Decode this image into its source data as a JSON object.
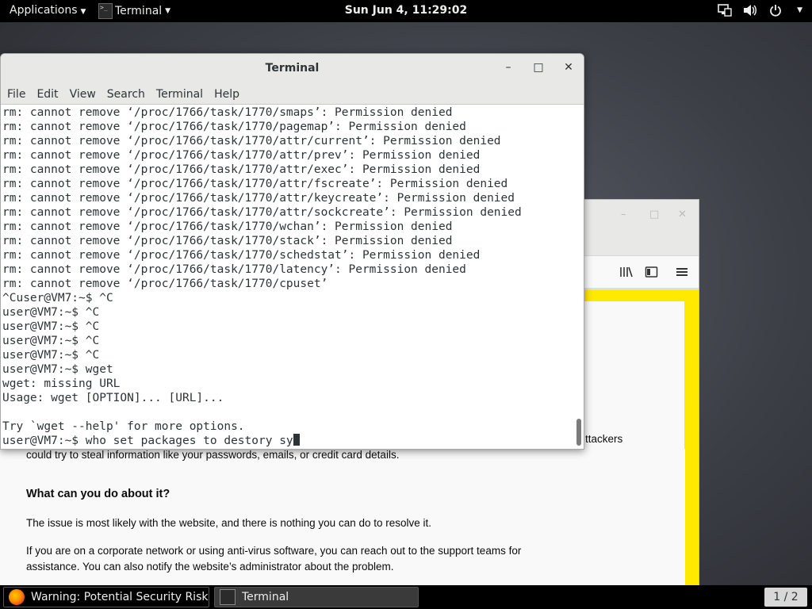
{
  "topbar": {
    "applications_label": "Applications",
    "app_menu_label": "Terminal",
    "clock": "Sun Jun  4, 11:29:02",
    "tray_icons": [
      "network-icon",
      "volume-icon",
      "power-icon"
    ]
  },
  "terminal": {
    "title": "Terminal",
    "menus": [
      "File",
      "Edit",
      "View",
      "Search",
      "Terminal",
      "Help"
    ],
    "lines": [
      "rm: cannot remove ‘/proc/1766/task/1770/smaps’: Permission denied",
      "rm: cannot remove ‘/proc/1766/task/1770/pagemap’: Permission denied",
      "rm: cannot remove ‘/proc/1766/task/1770/attr/current’: Permission denied",
      "rm: cannot remove ‘/proc/1766/task/1770/attr/prev’: Permission denied",
      "rm: cannot remove ‘/proc/1766/task/1770/attr/exec’: Permission denied",
      "rm: cannot remove ‘/proc/1766/task/1770/attr/fscreate’: Permission denied",
      "rm: cannot remove ‘/proc/1766/task/1770/attr/keycreate’: Permission denied",
      "rm: cannot remove ‘/proc/1766/task/1770/attr/sockcreate’: Permission denied",
      "rm: cannot remove ‘/proc/1766/task/1770/wchan’: Permission denied",
      "rm: cannot remove ‘/proc/1766/task/1770/stack’: Permission denied",
      "rm: cannot remove ‘/proc/1766/task/1770/schedstat’: Permission denied",
      "rm: cannot remove ‘/proc/1766/task/1770/latency’: Permission denied",
      "rm: cannot remove ‘/proc/1766/task/1770/cpuset’",
      "^Cuser@VM7:~$ ^C",
      "user@VM7:~$ ^C",
      "user@VM7:~$ ^C",
      "user@VM7:~$ ^C",
      "user@VM7:~$ ^C",
      "user@VM7:~$ wget",
      "wget: missing URL",
      "Usage: wget [OPTION]... [URL]...",
      "",
      "Try `wget --help' for more options."
    ],
    "prompt_line": "user@VM7:~$ who set packages to destory sy"
  },
  "firefox_page": {
    "partial_text": "ttackers",
    "line1": "could try to steal information like your passwords, emails, or credit card details.",
    "heading": "What can you do about it?",
    "para1": "The issue is most likely with the website, and there is nothing you can do to resolve it.",
    "para2_line1": "If you are on a corporate network or using anti-virus software, you can reach out to the support teams for",
    "para2_line2": "assistance. You can also notify the website’s administrator about the problem."
  },
  "taskbar": {
    "tasks": [
      {
        "label": "Warning: Potential Security Risk A...",
        "icon": "firefox-icon"
      },
      {
        "label": "Terminal",
        "icon": "terminal-icon"
      }
    ],
    "workspace": "1 / 2"
  }
}
